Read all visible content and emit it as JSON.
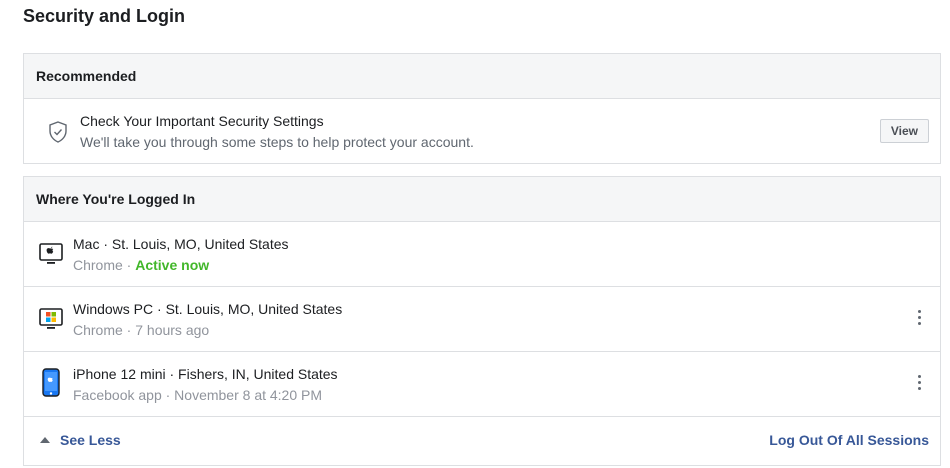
{
  "page": {
    "title": "Security and Login"
  },
  "recommended": {
    "header": "Recommended",
    "item": {
      "icon": "shield-check-icon",
      "title": "Check Your Important Security Settings",
      "subtitle": "We'll take you through some steps to help protect your account.",
      "button": "View"
    }
  },
  "sessions": {
    "header": "Where You're Logged In",
    "items": [
      {
        "icon": "mac-icon",
        "title": "Mac · St. Louis, MO, United States",
        "app": "Chrome · ",
        "status": "Active now"
      },
      {
        "icon": "windows-pc-icon",
        "title": "Windows PC · St. Louis, MO, United States",
        "app": "Chrome · 7 hours ago"
      },
      {
        "icon": "iphone-icon",
        "title": "iPhone 12 mini · Fishers, IN, United States",
        "app": "Facebook app · November 8 at 4:20 PM"
      }
    ],
    "see_less": "See Less",
    "logout_all": "Log Out Of All Sessions"
  },
  "colors": {
    "link": "#385898",
    "active": "#42b72a",
    "border": "#dddfe2",
    "header_bg": "#f5f6f7"
  }
}
